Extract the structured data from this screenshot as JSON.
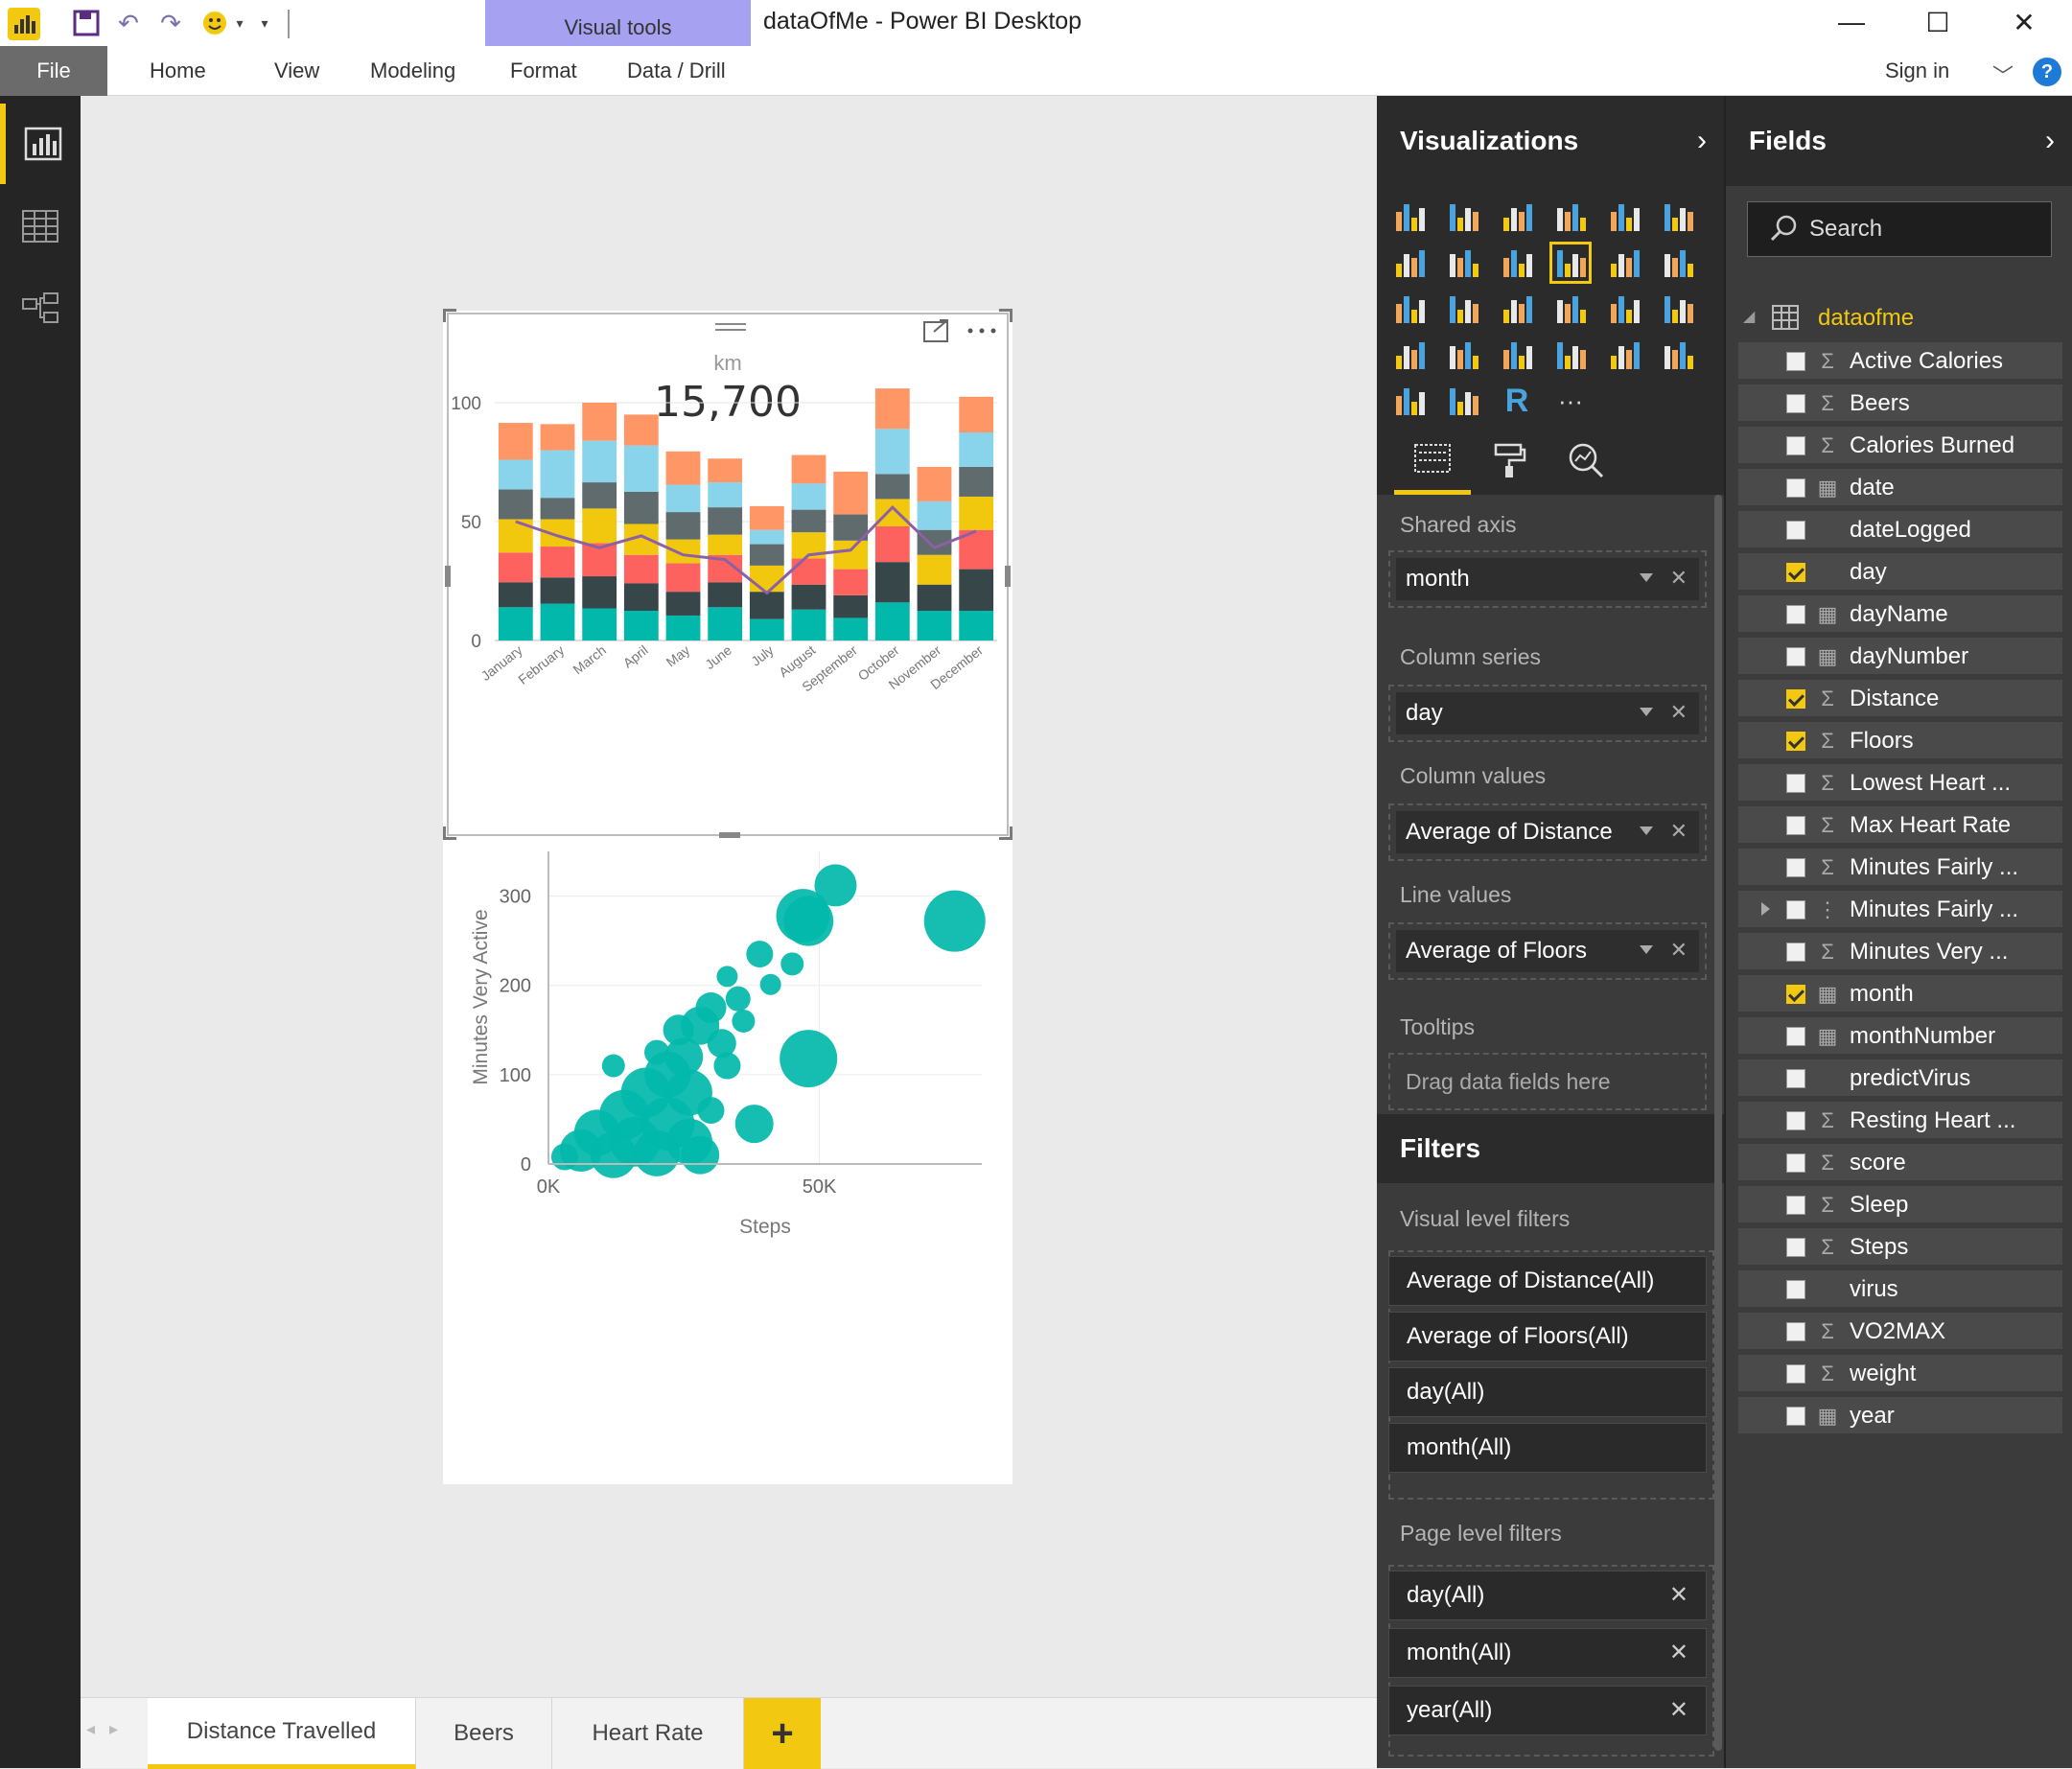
{
  "window": {
    "title": "dataOfMe - Power BI Desktop",
    "visual_tools_label": "Visual tools",
    "minimize": "—",
    "maximize": "☐",
    "close": "✕"
  },
  "ribbon": {
    "tabs": [
      "File",
      "Home",
      "View",
      "Modeling",
      "Format",
      "Data / Drill"
    ],
    "sign_in": "Sign in",
    "help": "?"
  },
  "left_nav": [
    "report-view",
    "data-view",
    "relationships-view"
  ],
  "chart1": {
    "card_label": "km",
    "card_value": "15,700",
    "chart_data": {
      "type": "bar",
      "categories": [
        "January",
        "February",
        "March",
        "April",
        "May",
        "June",
        "July",
        "August",
        "September",
        "October",
        "November",
        "December"
      ],
      "series": [
        {
          "values": [
            14,
            15.5,
            13.5,
            12.5,
            10.5,
            14,
            9,
            13,
            9.5,
            16,
            12.5,
            12.5
          ],
          "color": "#01b8aa"
        },
        {
          "values": [
            10.5,
            11,
            13.5,
            11.5,
            10,
            10.5,
            11.5,
            10.5,
            9.5,
            17,
            11,
            17.5
          ],
          "color": "#374649"
        },
        {
          "values": [
            12.5,
            13,
            14,
            12,
            12,
            11.5,
            0,
            11,
            11,
            15,
            0,
            16.5
          ],
          "color": "#fd625e"
        },
        {
          "values": [
            14,
            11.5,
            14.5,
            13,
            10,
            8.5,
            11,
            11,
            12,
            11.5,
            12.5,
            14
          ],
          "color": "#f2c80f"
        },
        {
          "values": [
            12.5,
            9,
            11,
            13.5,
            11.5,
            11.5,
            9,
            9.5,
            11,
            10.5,
            10.5,
            12.5
          ],
          "color": "#5f6b6d"
        },
        {
          "values": [
            12.5,
            20,
            17.5,
            19.5,
            11.5,
            10.5,
            6,
            11,
            0,
            19,
            12,
            14.5
          ],
          "color": "#8ad4eb"
        },
        {
          "values": [
            15.5,
            11,
            16,
            13,
            14,
            10,
            10,
            12,
            18,
            17,
            14.5,
            15
          ],
          "color": "#fe9666"
        }
      ],
      "line": {
        "name": "Average of Floors",
        "values": [
          50,
          44,
          39,
          44,
          36,
          34,
          20,
          36,
          38,
          56,
          39,
          46
        ],
        "color": "#8d5fa5"
      },
      "ylim": [
        0,
        100
      ],
      "yticks": [
        0,
        50,
        100
      ]
    }
  },
  "chart2": {
    "chart_data": {
      "type": "scatter",
      "xlabel": "Steps",
      "ylabel": "Minutes Very Active",
      "xticks": [
        "0K",
        "50K"
      ],
      "yticks": [
        0,
        100,
        200,
        300
      ],
      "xlim": [
        0,
        80000
      ],
      "ylim": [
        0,
        350
      ],
      "color": "#01b8aa",
      "points": [
        {
          "x": 53000,
          "y": 312,
          "r": 22
        },
        {
          "x": 48000,
          "y": 272,
          "r": 26
        },
        {
          "x": 47000,
          "y": 278,
          "r": 28
        },
        {
          "x": 75000,
          "y": 272,
          "r": 32
        },
        {
          "x": 39000,
          "y": 235,
          "r": 14
        },
        {
          "x": 45000,
          "y": 224,
          "r": 12
        },
        {
          "x": 41000,
          "y": 201,
          "r": 11
        },
        {
          "x": 48000,
          "y": 118,
          "r": 30
        },
        {
          "x": 38000,
          "y": 45,
          "r": 20
        },
        {
          "x": 30000,
          "y": 175,
          "r": 16
        },
        {
          "x": 28000,
          "y": 155,
          "r": 20
        },
        {
          "x": 35000,
          "y": 185,
          "r": 13
        },
        {
          "x": 33000,
          "y": 110,
          "r": 14
        },
        {
          "x": 30000,
          "y": 60,
          "r": 14
        },
        {
          "x": 12000,
          "y": 110,
          "r": 12
        },
        {
          "x": 20000,
          "y": 125,
          "r": 13
        },
        {
          "x": 25000,
          "y": 120,
          "r": 20
        },
        {
          "x": 22000,
          "y": 100,
          "r": 24
        },
        {
          "x": 18000,
          "y": 80,
          "r": 26
        },
        {
          "x": 26000,
          "y": 80,
          "r": 24
        },
        {
          "x": 14000,
          "y": 55,
          "r": 26
        },
        {
          "x": 22000,
          "y": 45,
          "r": 28
        },
        {
          "x": 9000,
          "y": 35,
          "r": 24
        },
        {
          "x": 16000,
          "y": 25,
          "r": 26
        },
        {
          "x": 26000,
          "y": 25,
          "r": 24
        },
        {
          "x": 6000,
          "y": 15,
          "r": 22
        },
        {
          "x": 12000,
          "y": 10,
          "r": 24
        },
        {
          "x": 20000,
          "y": 12,
          "r": 24
        },
        {
          "x": 28000,
          "y": 10,
          "r": 20
        },
        {
          "x": 3000,
          "y": 8,
          "r": 14
        },
        {
          "x": 32000,
          "y": 135,
          "r": 15
        },
        {
          "x": 36000,
          "y": 160,
          "r": 12
        },
        {
          "x": 24000,
          "y": 150,
          "r": 16
        },
        {
          "x": 33000,
          "y": 210,
          "r": 11
        }
      ]
    }
  },
  "page_tabs": [
    "Distance Travelled",
    "Beers",
    "Heart Rate"
  ],
  "page_tabs_add": "+",
  "visualizations": {
    "title": "Visualizations",
    "more": "···",
    "wells": {
      "shared_axis": {
        "label": "Shared axis",
        "value": "month"
      },
      "column_series": {
        "label": "Column series",
        "value": "day"
      },
      "column_values": {
        "label": "Column values",
        "value": "Average of Distance"
      },
      "line_values": {
        "label": "Line values",
        "value": "Average of Floors"
      },
      "tooltips": {
        "label": "Tooltips",
        "placeholder": "Drag data fields here"
      }
    }
  },
  "filters": {
    "title": "Filters",
    "visual_label": "Visual level filters",
    "visual": [
      "Average of Distance(All)",
      "Average of Floors(All)",
      "day(All)",
      "month(All)"
    ],
    "page_label": "Page level filters",
    "page": [
      "day(All)",
      "month(All)",
      "year(All)"
    ]
  },
  "fields": {
    "title": "Fields",
    "search_placeholder": "Search",
    "table": "dataofme",
    "items": [
      {
        "name": "Active Calories",
        "checked": false,
        "type": "sigma"
      },
      {
        "name": "Beers",
        "checked": false,
        "type": "sigma"
      },
      {
        "name": "Calories Burned",
        "checked": false,
        "type": "sigma"
      },
      {
        "name": "date",
        "checked": false,
        "type": "calc"
      },
      {
        "name": "dateLogged",
        "checked": false,
        "type": "none"
      },
      {
        "name": "day",
        "checked": true,
        "type": "none"
      },
      {
        "name": "dayName",
        "checked": false,
        "type": "calc"
      },
      {
        "name": "dayNumber",
        "checked": false,
        "type": "calc"
      },
      {
        "name": "Distance",
        "checked": true,
        "type": "sigma"
      },
      {
        "name": "Floors",
        "checked": true,
        "type": "sigma"
      },
      {
        "name": "Lowest Heart ...",
        "checked": false,
        "type": "sigma"
      },
      {
        "name": "Max Heart Rate",
        "checked": false,
        "type": "sigma"
      },
      {
        "name": "Minutes Fairly ...",
        "checked": false,
        "type": "sigma"
      },
      {
        "name": "Minutes Fairly ...",
        "checked": false,
        "type": "hierarchy",
        "expandable": true
      },
      {
        "name": "Minutes Very ...",
        "checked": false,
        "type": "sigma"
      },
      {
        "name": "month",
        "checked": true,
        "type": "calc"
      },
      {
        "name": "monthNumber",
        "checked": false,
        "type": "calc"
      },
      {
        "name": "predictVirus",
        "checked": false,
        "type": "none"
      },
      {
        "name": "Resting Heart ...",
        "checked": false,
        "type": "sigma"
      },
      {
        "name": "score",
        "checked": false,
        "type": "sigma"
      },
      {
        "name": "Sleep",
        "checked": false,
        "type": "sigma"
      },
      {
        "name": "Steps",
        "checked": false,
        "type": "sigma"
      },
      {
        "name": "virus",
        "checked": false,
        "type": "none"
      },
      {
        "name": "VO2MAX",
        "checked": false,
        "type": "sigma"
      },
      {
        "name": "weight",
        "checked": false,
        "type": "sigma"
      },
      {
        "name": "year",
        "checked": false,
        "type": "calc"
      }
    ]
  }
}
